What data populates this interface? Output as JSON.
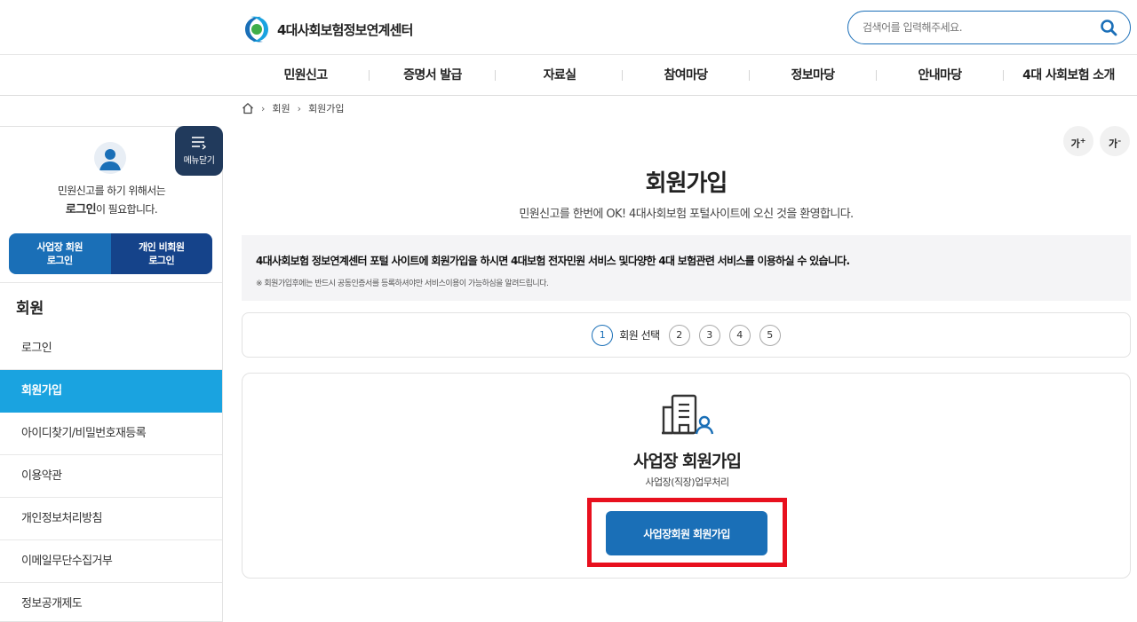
{
  "header": {
    "site_name": "4대사회보험정보연계센터",
    "search_placeholder": "검색어를 입력해주세요."
  },
  "gnb": [
    {
      "label": "민원신고"
    },
    {
      "label": "증명서 발급"
    },
    {
      "label": "자료실"
    },
    {
      "label": "참여마당"
    },
    {
      "label": "정보마당"
    },
    {
      "label": "안내마당"
    },
    {
      "label": "4대 사회보험 소개"
    }
  ],
  "breadcrumb": {
    "items": [
      "회원",
      "회원가입"
    ]
  },
  "sidebar": {
    "menu_close_label": "메뉴닫기",
    "login_msg_line1": "민원신고를 하기 위해서는",
    "login_msg_bold": "로그인",
    "login_msg_rest": "이 필요합니다.",
    "biz_login": {
      "line1": "사업장 회원",
      "line2": "로그인"
    },
    "personal_login": {
      "line1": "개인 비회원",
      "line2": "로그인"
    },
    "section_title": "회원",
    "menu": [
      {
        "label": "로그인",
        "active": false
      },
      {
        "label": "회원가입",
        "active": true
      },
      {
        "label": "아이디찾기/비밀번호재등록",
        "active": false
      },
      {
        "label": "이용약관",
        "active": false
      },
      {
        "label": "개인정보처리방침",
        "active": false
      },
      {
        "label": "이메일무단수집거부",
        "active": false
      },
      {
        "label": "정보공개제도",
        "active": false
      }
    ]
  },
  "font_size": {
    "increase": "가",
    "decrease": "가"
  },
  "main": {
    "title": "회원가입",
    "subtitle": "민원신고를 한번에 OK! 4대사회보험 포털사이트에 오신 것을 환영합니다.",
    "notice_main": "4대사회보험 정보연계센터 포털 사이트에 회원가입을 하시면 4대보험 전자민원 서비스 및다양한 4대 보험관련 서비스를 이용하실 수 있습니다.",
    "notice_sub": "※ 회원가입후에는 반드시 공동인증서를 등록하셔야만 서비스이용이 가능하심을 알려드립니다.",
    "steps": {
      "numbers": [
        "1",
        "2",
        "3",
        "4",
        "5"
      ],
      "current_label": "회원 선택"
    },
    "card": {
      "title": "사업장 회원가입",
      "desc": "사업장(직장)업무처리",
      "button": "사업장회원 회원가입"
    }
  },
  "colors": {
    "primary": "#1a6fb7",
    "navy": "#15438a",
    "active_menu": "#1aa3e0",
    "highlight": "#e8101e"
  }
}
